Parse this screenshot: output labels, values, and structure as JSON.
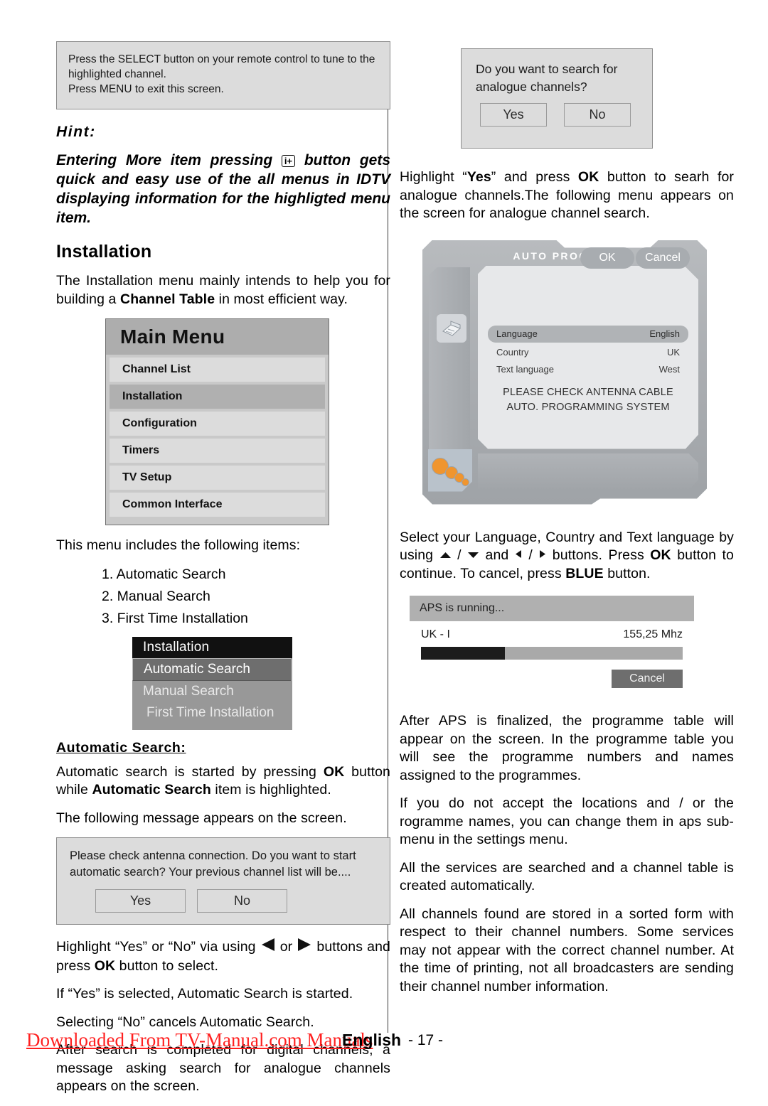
{
  "colors": {
    "accent_red": "#ff2020",
    "menu_header": "#adadad",
    "menu_item": "#dcdcdc",
    "menu_selected": "#b0b0b0",
    "dot_orange": "#f0952e"
  },
  "left": {
    "infobox": {
      "line1": "Press the SELECT button on your remote control to tune to the",
      "line2": "highlighted channel.",
      "line3": "Press MENU to exit this screen."
    },
    "hint_label": "Hint:",
    "hint_body_pre": "Entering More item pressing ",
    "hint_icon_label": "i+",
    "hint_body_post": " button gets quick  and easy use of the all menus in IDTV displaying information for the highligted menu item.",
    "section_title": "Installation",
    "intro_pre": "The Installation menu mainly intends to help you for building a ",
    "intro_bold": "Channel Table",
    "intro_post": " in most efficient way.",
    "main_menu": {
      "title": "Main Menu",
      "items": [
        {
          "label": "Channel List",
          "selected": false
        },
        {
          "label": "Installation",
          "selected": true
        },
        {
          "label": "Configuration",
          "selected": false
        },
        {
          "label": "Timers",
          "selected": false
        },
        {
          "label": "TV Setup",
          "selected": false
        },
        {
          "label": "Common Interface",
          "selected": false
        }
      ]
    },
    "includes_text": "This menu includes the following items:",
    "numbered_items": [
      "1. Automatic Search",
      "2. Manual Search",
      "3. First Time Installation"
    ],
    "submenu": {
      "title": "Installation",
      "items": [
        {
          "label": "Automatic Search",
          "selected": true
        },
        {
          "label": "Manual Search",
          "selected": false
        },
        {
          "label": "First Time Installation",
          "selected": false
        }
      ]
    },
    "auto_search_heading": "Automatic Search:",
    "auto_search_p1_a": "Automatic search is started by pressing ",
    "auto_search_p1_b": "OK",
    "auto_search_p1_c": " button while ",
    "auto_search_p1_d": "Automatic Search",
    "auto_search_p1_e": " item is highlighted.",
    "auto_search_p2": "The following message appears on the screen.",
    "confirm_dialog": {
      "line1": "Please check antenna connection. Do you want to start",
      "line2": "automatic search? Your previous channel list will be....",
      "yes": "Yes",
      "no": "No"
    },
    "p_highlight_a": "Highlight “Yes” or “No” via using ",
    "p_highlight_b": " or ",
    "p_highlight_c": " buttons and press ",
    "p_highlight_d": "OK",
    "p_highlight_e": " button to select.",
    "p_yes_selected": "If “Yes” is selected, Automatic Search is started.",
    "p_no_selected": "Selecting “No” cancels Automatic Search.",
    "p_after_search": "After search is completed for digital channels, a message asking search for analogue channels appears on the screen."
  },
  "right": {
    "analogue_dialog": {
      "line1": "Do you want to search for",
      "line2": "analogue channels?",
      "yes": "Yes",
      "no": "No"
    },
    "p_highlight_a": "Highlight “",
    "p_highlight_yes": "Yes",
    "p_highlight_b": "” and press ",
    "p_highlight_ok": "OK",
    "p_highlight_c": " button to searh for analogue channels.The following menu appears on the screen for analogue channel search.",
    "auto_program": {
      "title": "AUTO PROGRAM",
      "rows": [
        {
          "key": "Language",
          "value": "English",
          "selected": true
        },
        {
          "key": "Country",
          "value": "UK",
          "selected": false
        },
        {
          "key": "Text language",
          "value": "West",
          "selected": false
        }
      ],
      "message_line1": "PLEASE CHECK ANTENNA CABLE",
      "message_line2": "AUTO. PROGRAMMING SYSTEM",
      "ok": "OK",
      "cancel": "Cancel"
    },
    "p_select_a": "Select your Language, Country and Text language by using ",
    "p_select_b": " / ",
    "p_select_c": " and ",
    "p_select_d": " / ",
    "p_select_e": " buttons. Press ",
    "p_select_ok": "OK",
    "p_select_f": " button to continue. To cancel, press ",
    "p_select_blue": "BLUE",
    "p_select_g": " button.",
    "aps": {
      "header": "APS is running...",
      "channel": "UK  -  I",
      "frequency": "155,25  Mhz",
      "progress_percent": 32,
      "cancel": "Cancel"
    },
    "p_after_aps": " After APS is finalized, the programme table will appear on the screen. In the programme table you will see the programme numbers and names assigned to the programmes.",
    "p_not_accept": "If you do not accept the locations and / or the rogramme names, you can change them in aps sub-menu in the settings menu.",
    "p_all_services": "All the services are searched and a channel table is created automatically.",
    "p_all_channels": "All channels found are stored in a sorted form with respect to their channel numbers.  Some services may not appear with the correct channel number.  At the time of printing, not all broadcasters are sending their channel number information."
  },
  "footer": {
    "link": "Downloaded From TV-Manual.com Manuals",
    "language": "English",
    "page": "- 17 -"
  }
}
